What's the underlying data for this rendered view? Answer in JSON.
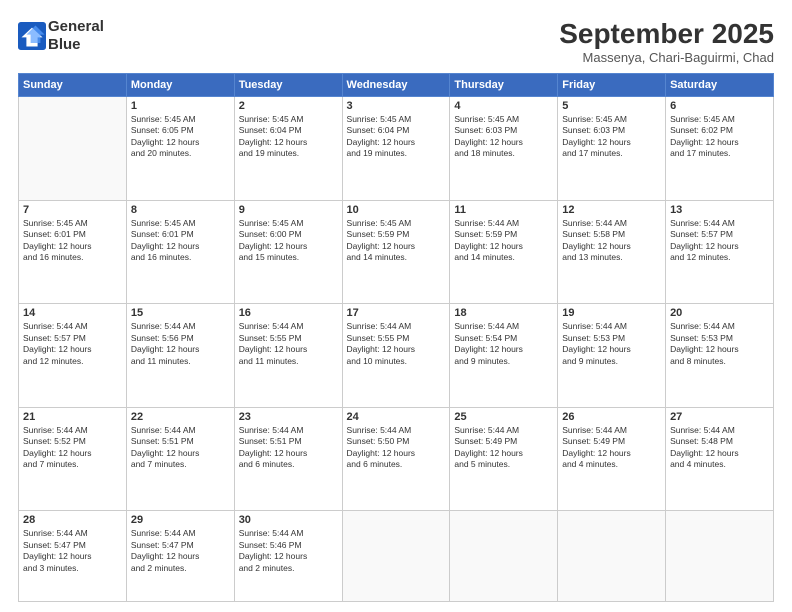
{
  "header": {
    "logo_line1": "General",
    "logo_line2": "Blue",
    "month": "September 2025",
    "location": "Massenya, Chari-Baguirmi, Chad"
  },
  "weekdays": [
    "Sunday",
    "Monday",
    "Tuesday",
    "Wednesday",
    "Thursday",
    "Friday",
    "Saturday"
  ],
  "weeks": [
    [
      {
        "day": "",
        "info": ""
      },
      {
        "day": "1",
        "info": "Sunrise: 5:45 AM\nSunset: 6:05 PM\nDaylight: 12 hours\nand 20 minutes."
      },
      {
        "day": "2",
        "info": "Sunrise: 5:45 AM\nSunset: 6:04 PM\nDaylight: 12 hours\nand 19 minutes."
      },
      {
        "day": "3",
        "info": "Sunrise: 5:45 AM\nSunset: 6:04 PM\nDaylight: 12 hours\nand 19 minutes."
      },
      {
        "day": "4",
        "info": "Sunrise: 5:45 AM\nSunset: 6:03 PM\nDaylight: 12 hours\nand 18 minutes."
      },
      {
        "day": "5",
        "info": "Sunrise: 5:45 AM\nSunset: 6:03 PM\nDaylight: 12 hours\nand 17 minutes."
      },
      {
        "day": "6",
        "info": "Sunrise: 5:45 AM\nSunset: 6:02 PM\nDaylight: 12 hours\nand 17 minutes."
      }
    ],
    [
      {
        "day": "7",
        "info": "Sunrise: 5:45 AM\nSunset: 6:01 PM\nDaylight: 12 hours\nand 16 minutes."
      },
      {
        "day": "8",
        "info": "Sunrise: 5:45 AM\nSunset: 6:01 PM\nDaylight: 12 hours\nand 16 minutes."
      },
      {
        "day": "9",
        "info": "Sunrise: 5:45 AM\nSunset: 6:00 PM\nDaylight: 12 hours\nand 15 minutes."
      },
      {
        "day": "10",
        "info": "Sunrise: 5:45 AM\nSunset: 5:59 PM\nDaylight: 12 hours\nand 14 minutes."
      },
      {
        "day": "11",
        "info": "Sunrise: 5:44 AM\nSunset: 5:59 PM\nDaylight: 12 hours\nand 14 minutes."
      },
      {
        "day": "12",
        "info": "Sunrise: 5:44 AM\nSunset: 5:58 PM\nDaylight: 12 hours\nand 13 minutes."
      },
      {
        "day": "13",
        "info": "Sunrise: 5:44 AM\nSunset: 5:57 PM\nDaylight: 12 hours\nand 12 minutes."
      }
    ],
    [
      {
        "day": "14",
        "info": "Sunrise: 5:44 AM\nSunset: 5:57 PM\nDaylight: 12 hours\nand 12 minutes."
      },
      {
        "day": "15",
        "info": "Sunrise: 5:44 AM\nSunset: 5:56 PM\nDaylight: 12 hours\nand 11 minutes."
      },
      {
        "day": "16",
        "info": "Sunrise: 5:44 AM\nSunset: 5:55 PM\nDaylight: 12 hours\nand 11 minutes."
      },
      {
        "day": "17",
        "info": "Sunrise: 5:44 AM\nSunset: 5:55 PM\nDaylight: 12 hours\nand 10 minutes."
      },
      {
        "day": "18",
        "info": "Sunrise: 5:44 AM\nSunset: 5:54 PM\nDaylight: 12 hours\nand 9 minutes."
      },
      {
        "day": "19",
        "info": "Sunrise: 5:44 AM\nSunset: 5:53 PM\nDaylight: 12 hours\nand 9 minutes."
      },
      {
        "day": "20",
        "info": "Sunrise: 5:44 AM\nSunset: 5:53 PM\nDaylight: 12 hours\nand 8 minutes."
      }
    ],
    [
      {
        "day": "21",
        "info": "Sunrise: 5:44 AM\nSunset: 5:52 PM\nDaylight: 12 hours\nand 7 minutes."
      },
      {
        "day": "22",
        "info": "Sunrise: 5:44 AM\nSunset: 5:51 PM\nDaylight: 12 hours\nand 7 minutes."
      },
      {
        "day": "23",
        "info": "Sunrise: 5:44 AM\nSunset: 5:51 PM\nDaylight: 12 hours\nand 6 minutes."
      },
      {
        "day": "24",
        "info": "Sunrise: 5:44 AM\nSunset: 5:50 PM\nDaylight: 12 hours\nand 6 minutes."
      },
      {
        "day": "25",
        "info": "Sunrise: 5:44 AM\nSunset: 5:49 PM\nDaylight: 12 hours\nand 5 minutes."
      },
      {
        "day": "26",
        "info": "Sunrise: 5:44 AM\nSunset: 5:49 PM\nDaylight: 12 hours\nand 4 minutes."
      },
      {
        "day": "27",
        "info": "Sunrise: 5:44 AM\nSunset: 5:48 PM\nDaylight: 12 hours\nand 4 minutes."
      }
    ],
    [
      {
        "day": "28",
        "info": "Sunrise: 5:44 AM\nSunset: 5:47 PM\nDaylight: 12 hours\nand 3 minutes."
      },
      {
        "day": "29",
        "info": "Sunrise: 5:44 AM\nSunset: 5:47 PM\nDaylight: 12 hours\nand 2 minutes."
      },
      {
        "day": "30",
        "info": "Sunrise: 5:44 AM\nSunset: 5:46 PM\nDaylight: 12 hours\nand 2 minutes."
      },
      {
        "day": "",
        "info": ""
      },
      {
        "day": "",
        "info": ""
      },
      {
        "day": "",
        "info": ""
      },
      {
        "day": "",
        "info": ""
      }
    ]
  ]
}
